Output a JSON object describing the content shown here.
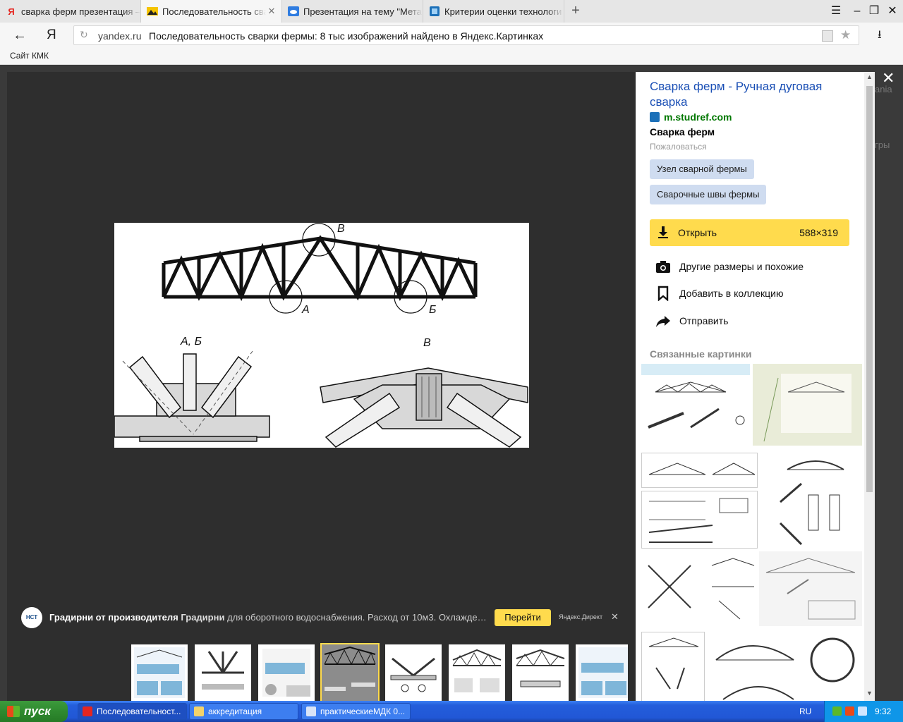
{
  "tabs": [
    {
      "title": "сварка ферм презентация –",
      "favicon": "yandex-icon"
    },
    {
      "title": "Последовательность сварки",
      "favicon": "yandex-images-icon"
    },
    {
      "title": "Презентация на тему \"Мета",
      "favicon": "cloud-icon"
    },
    {
      "title": "Критерии оценки технологи",
      "favicon": "book-icon"
    }
  ],
  "address": {
    "domain": "yandex.ru",
    "title": "Последовательность сварки фермы: 8 тыс изображений найдено в Яндекс.Картинках"
  },
  "bookmarks": [
    "Сайт КМК"
  ],
  "image": {
    "labels": {
      "top_b": "В",
      "node_a": "А",
      "node_b": "Б",
      "detail_ab": "А, Б",
      "detail_v": "В"
    }
  },
  "ad": {
    "logo": "НСТ",
    "title": "Градирни от производителя",
    "brand": "Градирни",
    "text": "для оборотного водоснабжения. Расход от 10м3. Охлаждение",
    "button": "Перейти",
    "source": "Яндекс.Директ"
  },
  "panel": {
    "title": "Сварка ферм - Ручная дуговая сварка",
    "site": "m.studref.com",
    "description": "Сварка ферм",
    "complain": "Пожаловаться",
    "tags": [
      "Узел сварной фермы",
      "Сварочные швы фермы"
    ],
    "open_label": "Открыть",
    "size": "588×319",
    "actions": [
      "Другие размеры и похожие",
      "Добавить в коллекцию",
      "Отправить"
    ],
    "related_heading": "Связанные картинки"
  },
  "edge_text": [
    "ania",
    "гры"
  ],
  "taskbar": {
    "start": "пуск",
    "tasks": [
      "Последовательност...",
      "аккредитация",
      "практическиеМДК 0..."
    ],
    "lang": "RU",
    "clock": "9:32"
  },
  "colors": {
    "accent": "#ffdb4d",
    "link": "#1a4fb5",
    "site": "#007700"
  }
}
